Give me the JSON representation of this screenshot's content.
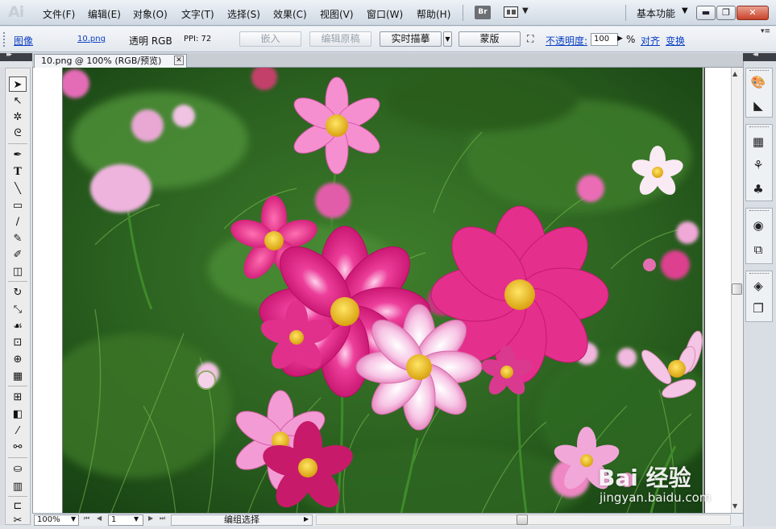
{
  "menubar": {
    "app_logo": "Ai",
    "items": [
      "文件(F)",
      "编辑(E)",
      "对象(O)",
      "文字(T)",
      "选择(S)",
      "效果(C)",
      "视图(V)",
      "窗口(W)",
      "帮助(H)"
    ],
    "bridge_label": "Br",
    "workspace": "基本功能",
    "window_buttons": [
      "▬",
      "❐",
      "✕"
    ]
  },
  "controlbar": {
    "object_type": "图像",
    "filename": "10.png",
    "mode": "透明 RGB",
    "ppi": "PPI: 72",
    "embed_label": "嵌入",
    "edit_original_label": "编辑原稿",
    "live_trace_label": "实时描摹",
    "mask_label": "蒙版",
    "opacity_label": "不透明度:",
    "opacity_value": "100",
    "opacity_unit": "%",
    "align_label": "对齐",
    "transform_label": "变换"
  },
  "document": {
    "tab_title": "10.png @ 100% (RGB/预览)"
  },
  "statusbar": {
    "zoom": "100%",
    "page": "1",
    "status": "编组选择"
  },
  "watermark": {
    "logo": "Bai 经验",
    "url": "jingyan.baidu.com"
  },
  "colors": {
    "menubar": "#dbe2ea",
    "foliage": "#2f6b22",
    "flower_pink": "#e8348f",
    "flower_light": "#f3a6d6",
    "flower_center": "#f2c21e"
  }
}
